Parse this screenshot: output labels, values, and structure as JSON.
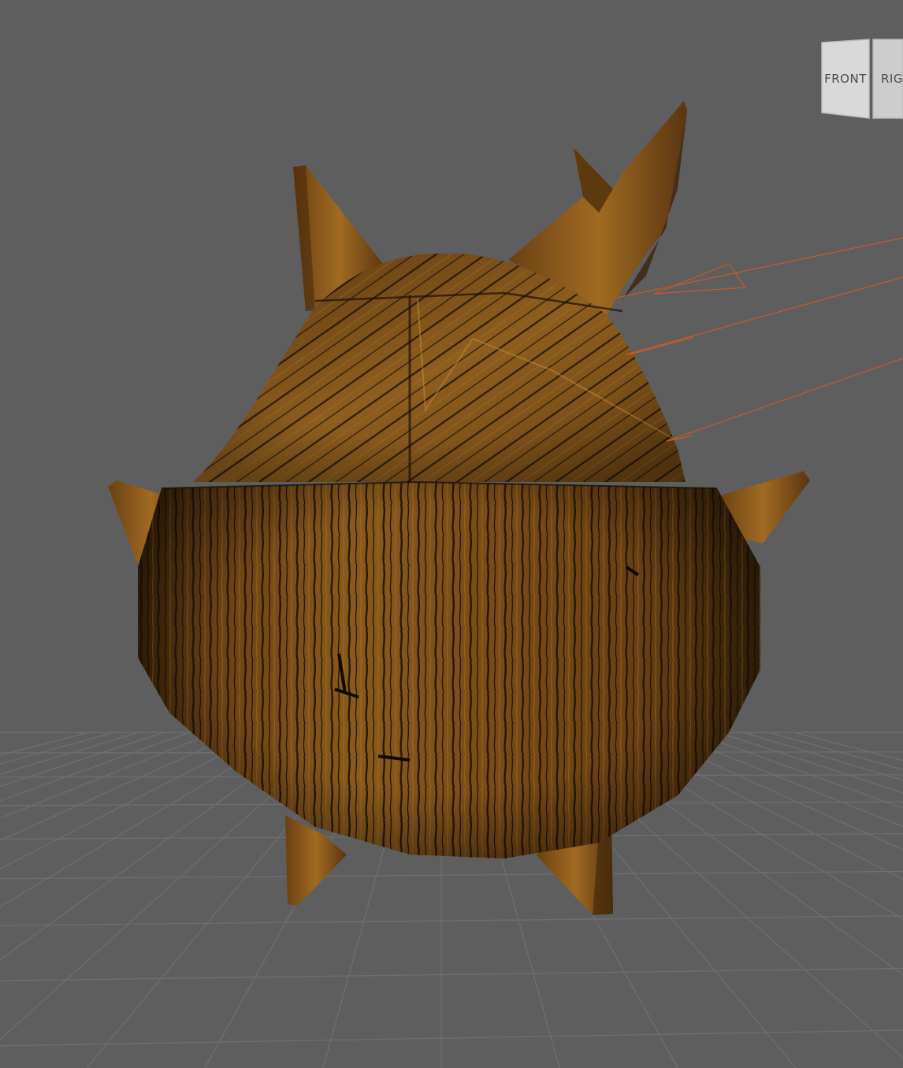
{
  "viewport": {
    "background": "#5e5e5e",
    "grid_color": "#6e6e6e",
    "selection_color": "#c85a2a"
  },
  "viewcube": {
    "front_label": "FRONT",
    "right_label": "RIG"
  },
  "model": {
    "material": "wood",
    "base_color": "#7a4a14",
    "dark_grain": "#1e1206",
    "light_grain": "#b07a2a"
  }
}
